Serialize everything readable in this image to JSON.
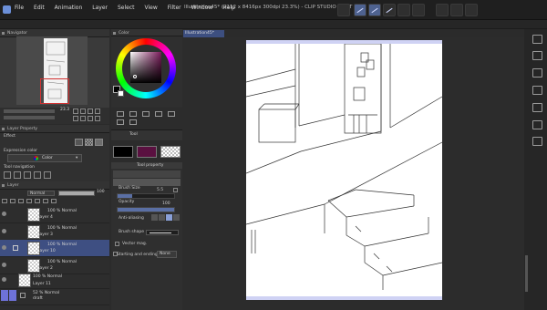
{
  "window": {
    "title": "Illustration45* (2112 x 8416px 300dpi 23.3%) - CLIP STUDIO PAINT PRO"
  },
  "menu": [
    "File",
    "Edit",
    "Animation",
    "Layer",
    "Select",
    "View",
    "Filter",
    "Window",
    "Help"
  ],
  "navigator": {
    "title": "Navigator",
    "zoom": "23.3"
  },
  "color_wheel": {
    "title": "Color"
  },
  "layer_property": {
    "title": "Layer Property",
    "effect_label": "Effect",
    "expression_color_label": "Expression color",
    "expression_color_value": "Color",
    "tool_navigation_label": "Tool navigation"
  },
  "layer_panel": {
    "title": "Layer",
    "blend_mode": "Normal",
    "opacity": "100",
    "layers": [
      {
        "mode": "100 % Normal",
        "name": "Layer 4"
      },
      {
        "mode": "100 % Normal",
        "name": "Layer 3"
      },
      {
        "mode": "100 % Normal",
        "name": "Layer 10",
        "selected": true
      },
      {
        "mode": "100 % Normal",
        "name": "Layer 2"
      },
      {
        "mode": "100 % Normal",
        "name": "Layer 11"
      },
      {
        "mode": "52 % Normal",
        "name": "draft"
      }
    ]
  },
  "tool_property": {
    "tab_tool": "Tool",
    "tab_prop": "Tool property",
    "brush_size_label": "Brush Size",
    "brush_size_value": "5.5",
    "opacity_label": "Opacity",
    "opacity_value": "100",
    "anti_alias_label": "Anti-aliasing",
    "brush_shape_label": "Brush shape",
    "vector_label": "Vector mag.",
    "start_end_label": "Starting and ending",
    "start_end_value": "None",
    "brush_size_fraction": 0.25,
    "opacity_fraction": 1.0
  },
  "canvas": {
    "tab_label": "Illustration45*"
  },
  "colors": {
    "main": "#000000",
    "sub": "#5a1040",
    "accent": "#4e6290"
  }
}
